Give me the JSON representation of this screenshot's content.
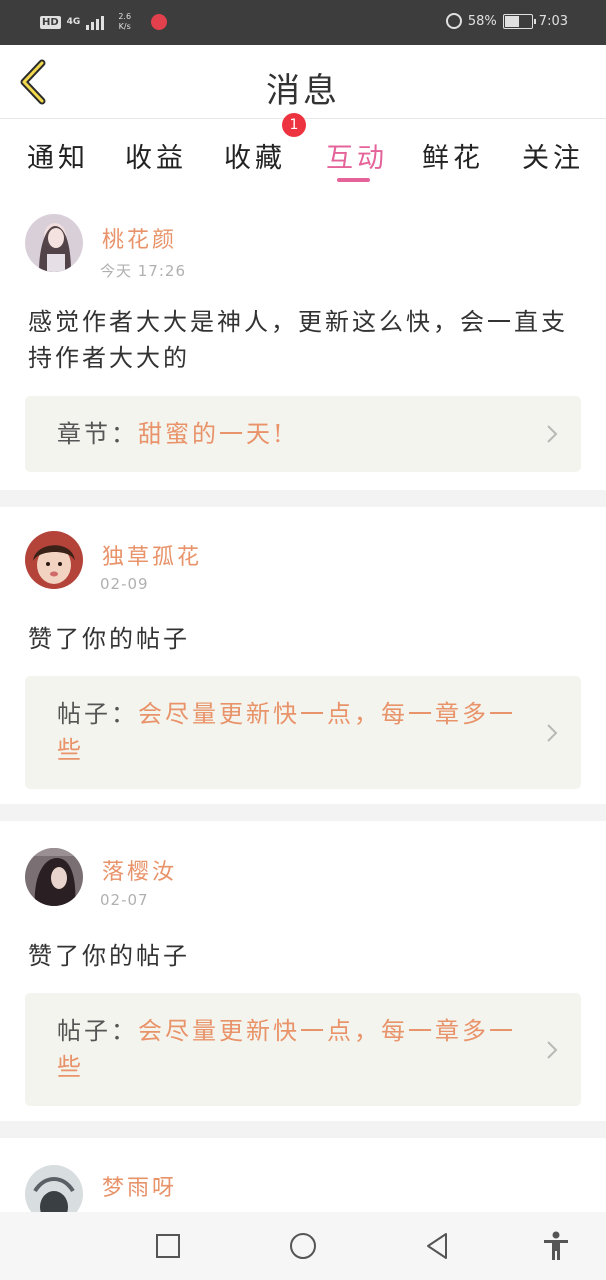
{
  "status_bar": {
    "hd": "HD",
    "network": "4G",
    "speed_value": "2.6",
    "speed_unit": "K/s",
    "battery_percent": "58%",
    "battery_level": 0.58,
    "time": "7:03"
  },
  "header": {
    "title": "消息",
    "back_icon": "chevron-left-icon"
  },
  "tabs": [
    {
      "label": "通知"
    },
    {
      "label": "收益"
    },
    {
      "label": "收藏",
      "badge": "1"
    },
    {
      "label": "互动",
      "active": true
    },
    {
      "label": "鲜花"
    },
    {
      "label": "关注"
    }
  ],
  "feed": [
    {
      "username": "桃花颜",
      "time": "今天 17:26",
      "content": "感觉作者大大是神人，更新这么快，会一直支持作者大大的",
      "ref_label": "章节：",
      "ref_value": "甜蜜的一天!"
    },
    {
      "username": "独草孤花",
      "time": "02-09",
      "content": "赞了你的帖子",
      "ref_label": "帖子：",
      "ref_value": "会尽量更新快一点，每一章多一些"
    },
    {
      "username": "落樱汝",
      "time": "02-07",
      "content": "赞了你的帖子",
      "ref_label": "帖子：",
      "ref_value": "会尽量更新快一点，每一章多一些"
    },
    {
      "username": "梦雨呀",
      "time": ""
    }
  ],
  "nav": {
    "recent": "square-icon",
    "home": "circle-icon",
    "back": "triangle-back-icon",
    "accessibility": "accessibility-icon"
  },
  "colors": {
    "accent_pink": "#e4649a",
    "accent_orange": "#e8936a",
    "badge_red": "#ee3340",
    "ref_bg": "#f4f4ee"
  }
}
